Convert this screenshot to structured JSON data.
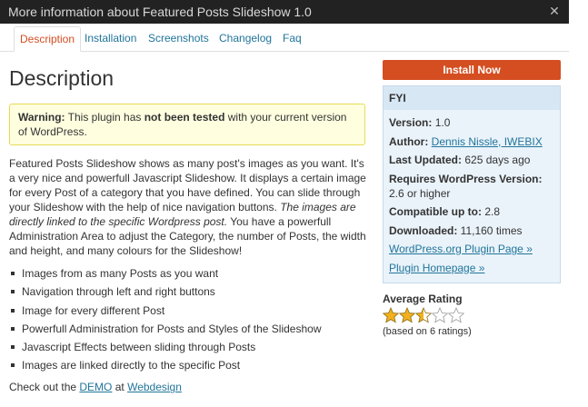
{
  "window": {
    "title": "More information about Featured Posts Slideshow 1.0"
  },
  "tabs": [
    {
      "label": "Description",
      "active": true
    },
    {
      "label": "Installation"
    },
    {
      "label": "Screenshots"
    },
    {
      "label": "Changelog"
    },
    {
      "label": "Faq"
    }
  ],
  "main": {
    "heading": "Description",
    "warning": {
      "prefix": "Warning:",
      "text1": " This plugin has ",
      "strong": "not been tested",
      "text2": " with your current version of WordPress."
    },
    "description": {
      "part1": "Featured Posts Slideshow shows as many post's images as you want. It's a very nice and powerfull Javascript Slideshow. It displays a certain image for every Post of a category that you have defined. You can slide through your Slideshow with the help of nice navigation buttons. ",
      "italic": "The images are directly linked to the specific Wordpress post.",
      "part2": " You have a powerfull Administration Area to adjust the Category, the number of Posts, the width and height, and many colours for the Slideshow!"
    },
    "features": [
      "Images from as many Posts as you want",
      "Navigation through left and right buttons",
      "Image for every different Post",
      "Powerfull Administration for Posts and Styles of the Slideshow",
      "Javascript Effects between sliding through Posts",
      "Images are linked directly to the specific Post"
    ],
    "checkout": {
      "prefix": "Check out the ",
      "demo_link": "DEMO",
      "middle": " at ",
      "site_link": "Webdesign"
    }
  },
  "sidebar": {
    "install_label": "Install Now",
    "fyi_title": "FYI",
    "version_label": "Version:",
    "version": "1.0",
    "author_label": "Author:",
    "author": "Dennis Nissle, IWEBIX",
    "updated_label": "Last Updated:",
    "updated": "625 days ago",
    "requires_label": "Requires WordPress Version:",
    "requires": "2.6 or higher",
    "compatible_label": "Compatible up to:",
    "compatible": "2.8",
    "downloaded_label": "Downloaded:",
    "downloaded": "11,160 times",
    "plugin_page_link": "WordPress.org Plugin Page »",
    "homepage_link": "Plugin Homepage »",
    "rating_title": "Average Rating",
    "rating_value": 2.5,
    "rating_max": 5,
    "rating_count": "(based on 6 ratings)",
    "star_color": "#f2b01e"
  }
}
